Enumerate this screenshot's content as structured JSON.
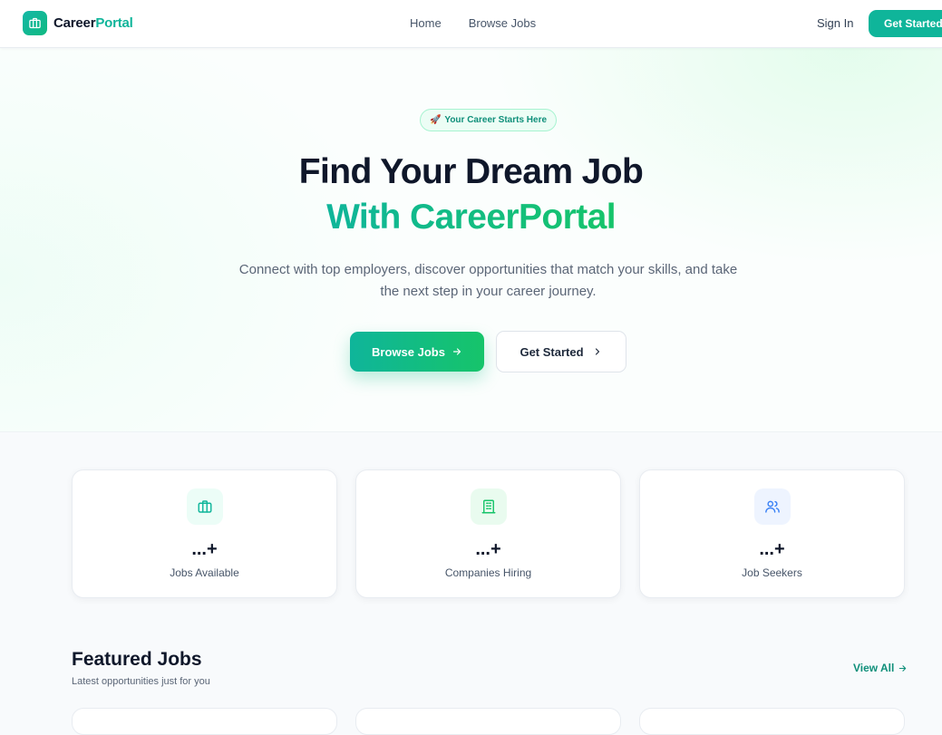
{
  "nav": {
    "logo_part1": "Career",
    "logo_part2": "Portal",
    "links": [
      {
        "label": "Home"
      },
      {
        "label": "Browse Jobs"
      }
    ],
    "sign_in": "Sign In",
    "cta": "Get Started"
  },
  "hero": {
    "pill_icon": "rocket-icon",
    "pill_text": "Your Career Starts Here",
    "title_line1": "Find Your Dream Job",
    "title_line2": "With CareerPortal",
    "subtitle": "Connect with top employers, discover opportunities that match your skills, and take the next step in your career journey.",
    "primary_button": "Browse Jobs",
    "secondary_button": "Get Started"
  },
  "stats": [
    {
      "icon": "briefcase-icon",
      "value": "...+",
      "label": "Jobs Available",
      "color": "#0fb59a"
    },
    {
      "icon": "building-icon",
      "value": "...+",
      "label": "Companies Hiring",
      "color": "#16c46a"
    },
    {
      "icon": "users-icon",
      "value": "...+",
      "label": "Job Seekers",
      "color": "#3b82f6"
    }
  ],
  "featured": {
    "title": "Featured Jobs",
    "subtitle": "Latest opportunities just for you",
    "view_all": "View All"
  },
  "colors": {
    "brand": "#0fb59a",
    "brand_green": "#16c46a",
    "text_dark": "#0f172a",
    "text_muted": "#5b6677"
  }
}
